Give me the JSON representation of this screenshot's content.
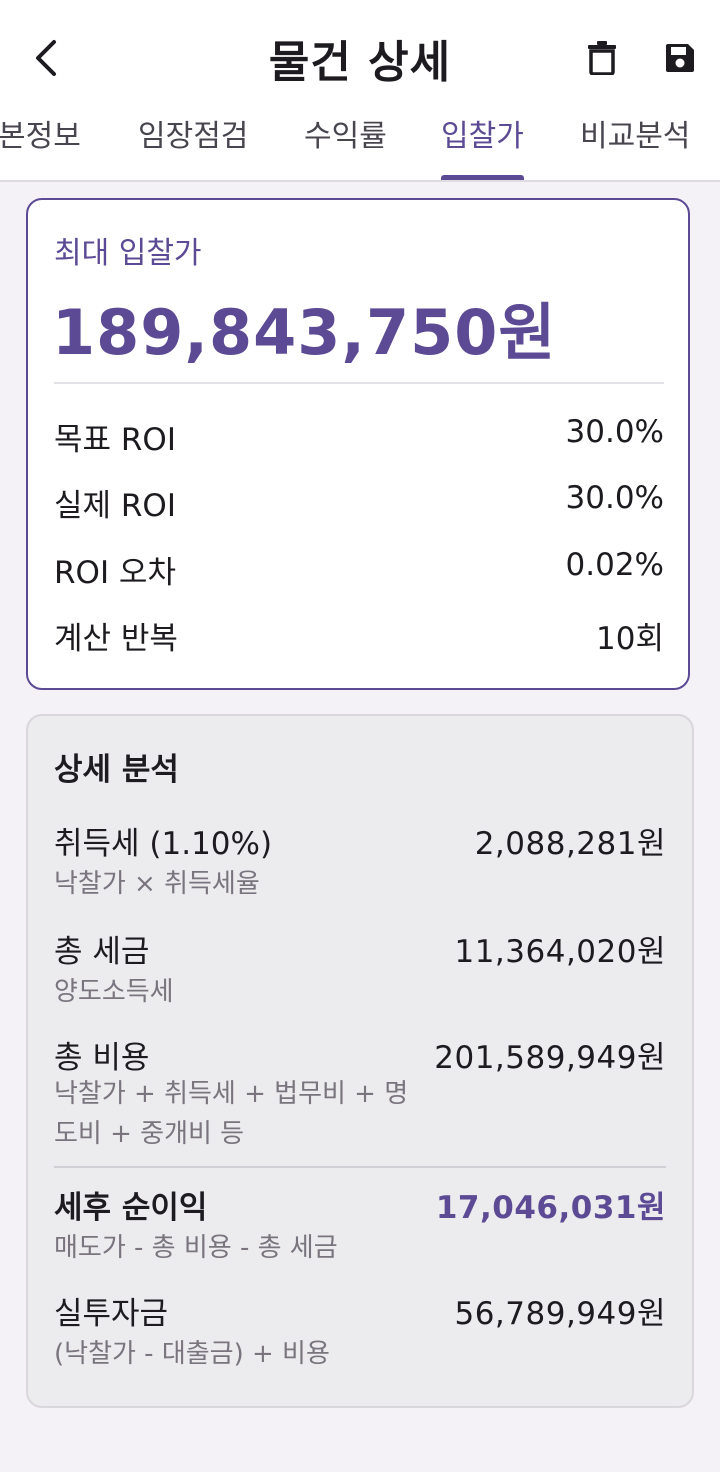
{
  "header": {
    "title": "물건 상세",
    "back_icon": "chevron-left-icon",
    "delete_icon": "trash-icon",
    "save_icon": "floppy-disk-icon"
  },
  "tabs": [
    {
      "label": "본정보",
      "active": false
    },
    {
      "label": "임장점검",
      "active": false
    },
    {
      "label": "수익률",
      "active": false
    },
    {
      "label": "입찰가",
      "active": true
    },
    {
      "label": "비교분석",
      "active": false
    }
  ],
  "max_bid": {
    "label": "최대 입찰가",
    "value": "189,843,750원",
    "rows": [
      {
        "label": "목표 ROI",
        "value": "30.0%"
      },
      {
        "label": "실제 ROI",
        "value": "30.0%"
      },
      {
        "label": "ROI 오차",
        "value": "0.02%"
      },
      {
        "label": "계산 반복",
        "value": "10회"
      }
    ]
  },
  "detail": {
    "title": "상세 분석",
    "items": [
      {
        "name": "취득세 (1.10%)",
        "amount": "2,088,281원",
        "desc": "낙찰가 × 취득세율"
      },
      {
        "name": "총 세금",
        "amount": "11,364,020원",
        "desc": "양도소득세"
      },
      {
        "name": "총 비용",
        "amount": "201,589,949원",
        "desc_line1": "낙찰가 + 취득세 + 법무비 + 명",
        "desc_line2": "도비 + 중개비 등"
      },
      {
        "name": "세후 순이익",
        "amount": "17,046,031원",
        "desc": "매도가 - 총 비용 - 총 세금"
      },
      {
        "name": "실투자금",
        "amount": "56,789,949원",
        "desc": "(낙찰가 - 대출금) + 비용"
      }
    ]
  },
  "colors": {
    "accent": "#5c4a94",
    "background": "#f4f2f6",
    "card_detail_bg": "#ecebee",
    "muted_text": "#79747e"
  }
}
